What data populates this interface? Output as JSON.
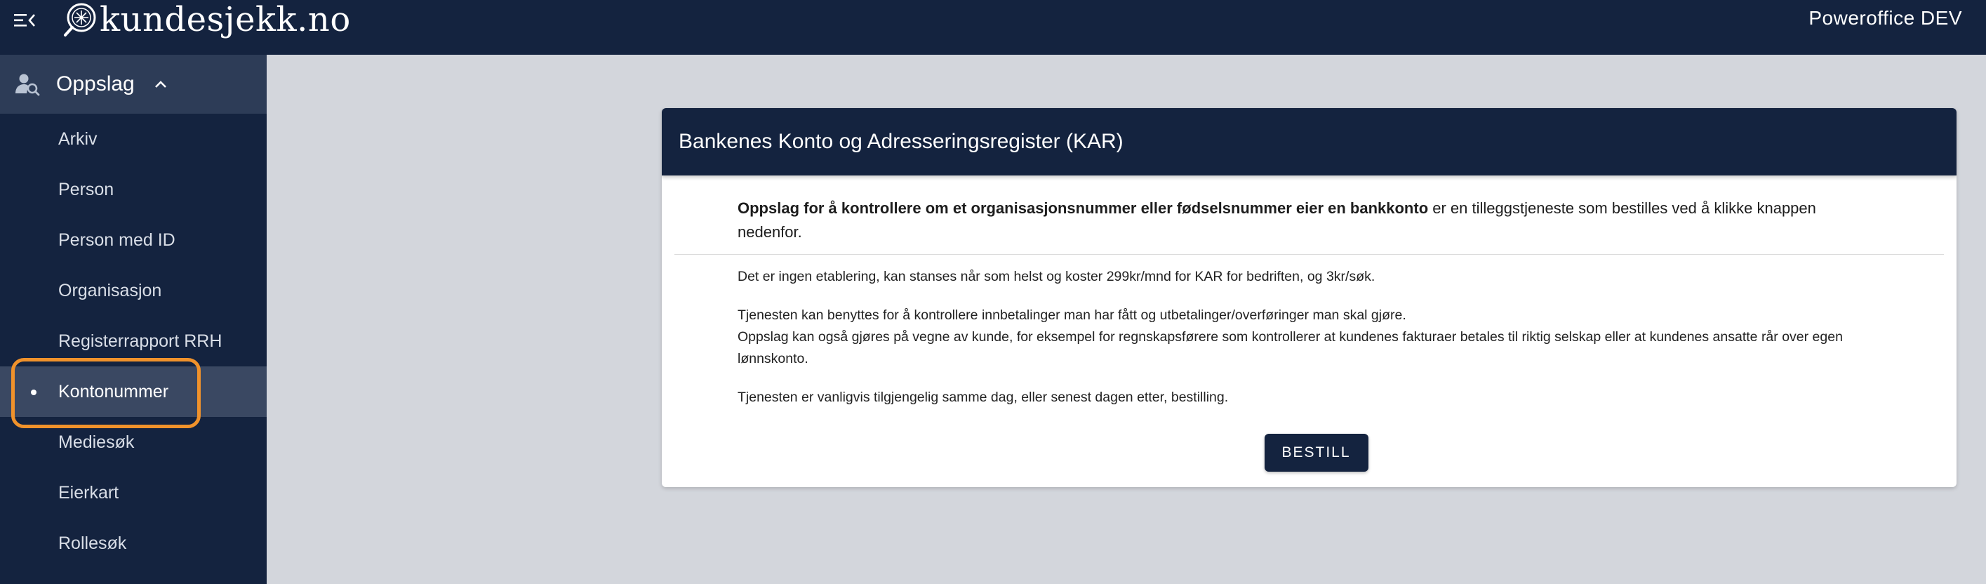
{
  "topbar": {
    "brand": "kundesjekk.no",
    "tenant": "Poweroffice DEV"
  },
  "sidebar": {
    "section": "Oppslag",
    "items": [
      {
        "label": "Arkiv"
      },
      {
        "label": "Person"
      },
      {
        "label": "Person med ID"
      },
      {
        "label": "Organisasjon"
      },
      {
        "label": "Registerrapport RRH"
      },
      {
        "label": "Kontonummer",
        "active": true
      },
      {
        "label": "Mediesøk"
      },
      {
        "label": "Eierkart"
      },
      {
        "label": "Rollesøk"
      }
    ]
  },
  "card": {
    "title": "Bankenes Konto og Adresseringsregister (KAR)",
    "intro_bold": "Oppslag for å kontrollere om et organisasjonsnummer eller fødselsnummer eier en bankkonto",
    "intro_rest": " er en tilleggstjeneste som bestilles ved å klikke knappen nedenfor.",
    "para1": "Det er ingen etablering, kan stanses når som helst og koster 299kr/mnd for KAR for bedriften, og 3kr/søk.",
    "para2a": "Tjenesten kan benyttes for å kontrollere innbetalinger man har fått og utbetalinger/overføringer man skal gjøre.",
    "para2b": "Oppslag kan også gjøres på vegne av kunde, for eksempel for regnskapsførere som kontrollerer at kundenes fakturaer betales til riktig selskap eller at kundenes ansatte rår over egen lønnskonto.",
    "para3": "Tjenesten er vanligvis tilgjengelig samme dag, eller senest dagen etter, bestilling.",
    "button": "BESTILL"
  },
  "colors": {
    "navy": "#14233f",
    "sidebar_section": "#2d3c57",
    "active_item": "#3a4862",
    "highlight": "#f0922b",
    "background": "#d3d6dc"
  },
  "icons": {
    "menu": "menu-collapse-icon",
    "logo": "magnifier-logo-icon",
    "section": "person-search-icon",
    "chevron": "chevron-up-icon"
  }
}
